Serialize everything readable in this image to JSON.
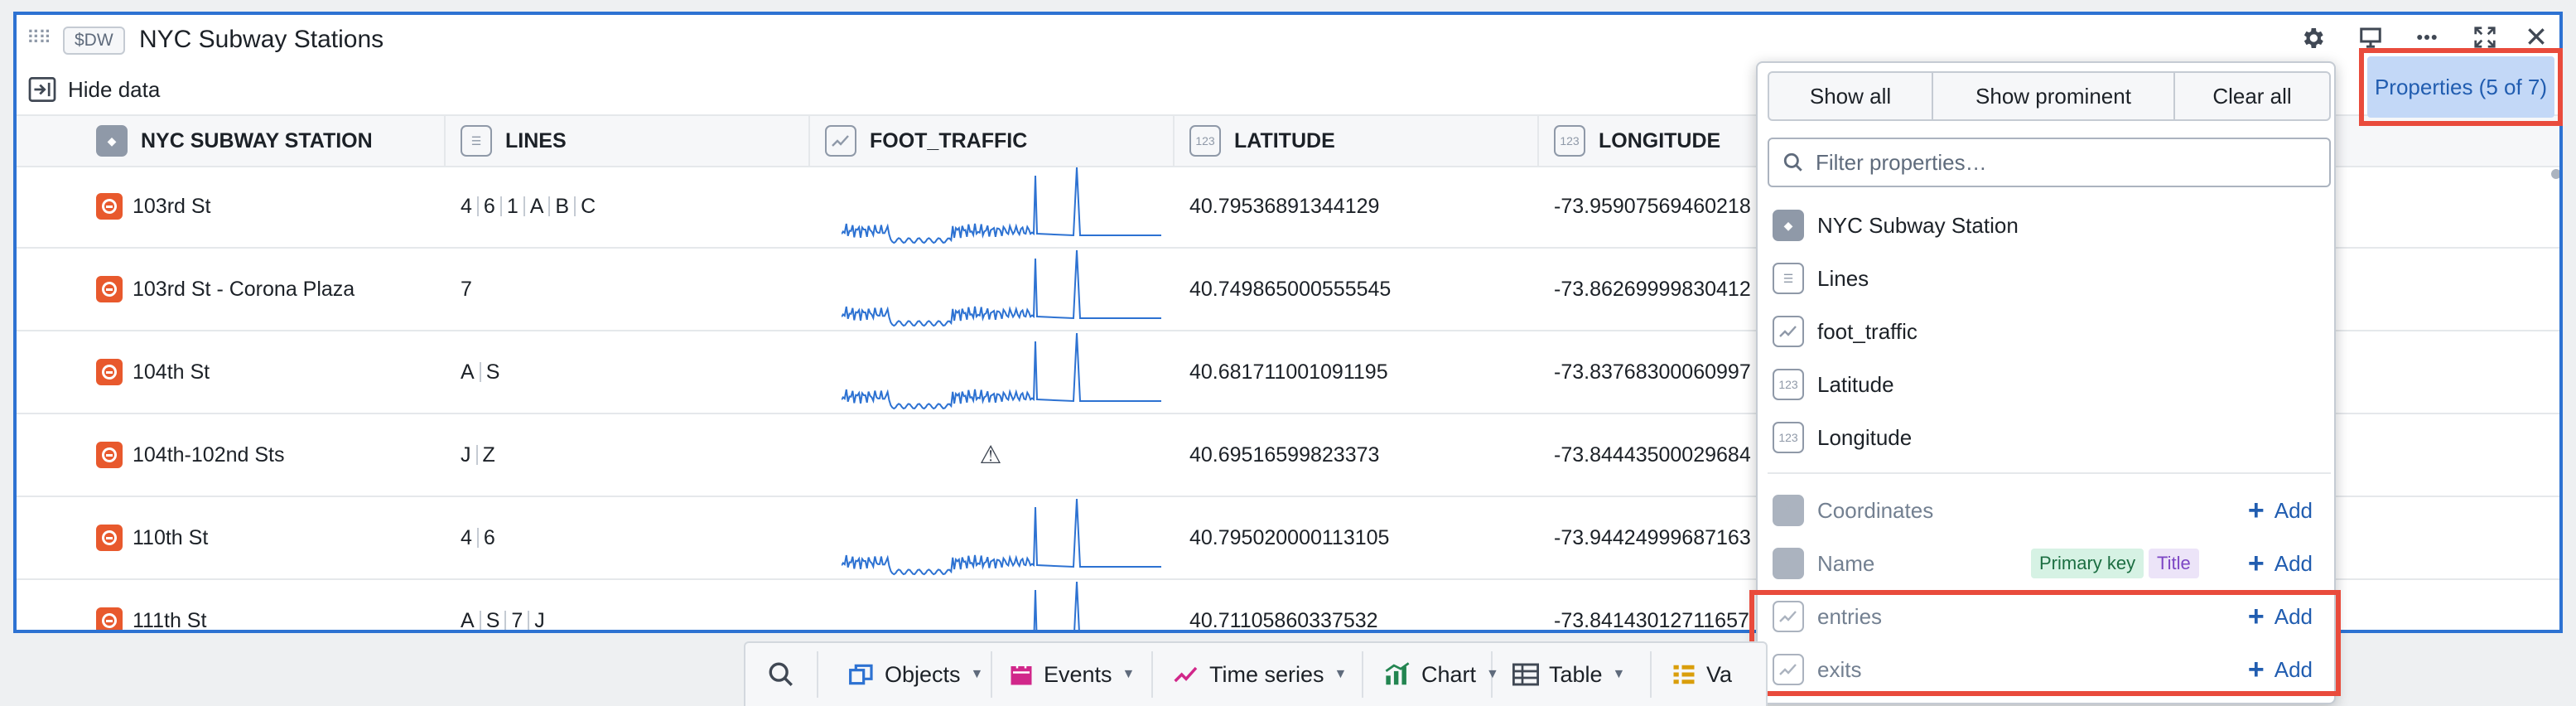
{
  "widget": {
    "tag": "$DW",
    "title": "NYC Subway Stations",
    "hide_data_label": "Hide data",
    "toolbar_icons": [
      "gear-icon",
      "present-icon",
      "more-icon",
      "fullscreen-icon",
      "close-icon"
    ]
  },
  "table": {
    "columns": [
      {
        "label": "NYC SUBWAY STATION",
        "icon": "object-icon"
      },
      {
        "label": "LINES",
        "icon": "list-icon"
      },
      {
        "label": "FOOT_TRAFFIC",
        "icon": "timeseries-icon"
      },
      {
        "label": "LATITUDE",
        "icon": "number-icon"
      },
      {
        "label": "LONGITUDE",
        "icon": "number-icon"
      }
    ],
    "number_icon_text": "123",
    "rows": [
      {
        "station": "103rd St",
        "lines": [
          "4",
          "6",
          "1",
          "A",
          "B",
          "C"
        ],
        "traffic": "sparkline",
        "latitude": "40.79536891344129",
        "longitude": "-73.95907569460218"
      },
      {
        "station": "103rd St - Corona Plaza",
        "lines": [
          "7"
        ],
        "traffic": "sparkline",
        "latitude": "40.749865000555545",
        "longitude": "-73.86269999830412"
      },
      {
        "station": "104th St",
        "lines": [
          "A",
          "S"
        ],
        "traffic": "sparkline",
        "latitude": "40.681711001091195",
        "longitude": "-73.83768300060997"
      },
      {
        "station": "104th-102nd Sts",
        "lines": [
          "J",
          "Z"
        ],
        "traffic": "warning",
        "latitude": "40.69516599823373",
        "longitude": "-73.84443500029684"
      },
      {
        "station": "110th St",
        "lines": [
          "4",
          "6"
        ],
        "traffic": "sparkline",
        "latitude": "40.795020000113105",
        "longitude": "-73.94424999687163"
      },
      {
        "station": "111th St",
        "lines": [
          "A",
          "S",
          "7",
          "J"
        ],
        "traffic": "sparkline",
        "latitude": "40.71105860337532",
        "longitude": "-73.84143012711657"
      }
    ]
  },
  "properties_panel": {
    "button_label": "Properties (5 of 7)",
    "actions": [
      "Show all",
      "Show prominent",
      "Clear all"
    ],
    "filter_placeholder": "Filter properties…",
    "shown": [
      {
        "label": "NYC Subway Station",
        "icon": "object-icon"
      },
      {
        "label": "Lines",
        "icon": "list-icon"
      },
      {
        "label": "foot_traffic",
        "icon": "timeseries-icon"
      },
      {
        "label": "Latitude",
        "icon": "number-icon"
      },
      {
        "label": "Longitude",
        "icon": "number-icon"
      }
    ],
    "hidden": [
      {
        "label": "Coordinates",
        "icon": "quote-icon",
        "badges": []
      },
      {
        "label": "Name",
        "icon": "quote-icon",
        "badges": [
          "Primary key",
          "Title"
        ]
      },
      {
        "label": "entries",
        "icon": "timeseries-icon",
        "badges": []
      },
      {
        "label": "exits",
        "icon": "timeseries-icon",
        "badges": []
      }
    ],
    "add_label": "Add"
  },
  "bottom_toolbar": {
    "items": [
      {
        "label": "Objects",
        "icon": "objects-icon",
        "color": "#2d72d2"
      },
      {
        "label": "Events",
        "icon": "calendar-icon",
        "color": "#d1278a"
      },
      {
        "label": "Time series",
        "icon": "timeseries-icon",
        "color": "#d1278a"
      },
      {
        "label": "Chart",
        "icon": "chart-icon",
        "color": "#238551"
      },
      {
        "label": "Table",
        "icon": "table-icon",
        "color": "#404854"
      },
      {
        "label": "Va",
        "icon": "variable-icon",
        "color": "#d99e0b"
      }
    ]
  },
  "colors": {
    "accent": "#2d72d2",
    "highlight": "#e94b3c",
    "object_icon": "#e8592d",
    "sparkline": "#2d72d2"
  }
}
